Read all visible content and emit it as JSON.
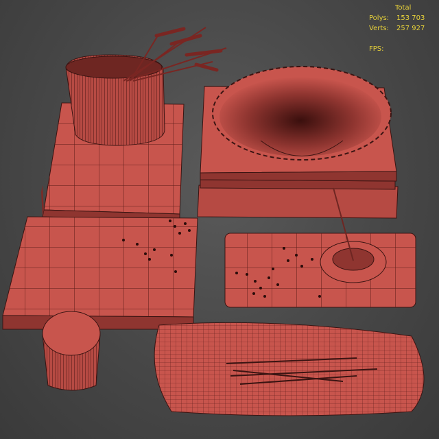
{
  "stats": {
    "header": "Total",
    "polys_label": "Polys:",
    "polys_value": "153 703",
    "verts_label": "Verts:",
    "verts_value": "257 927",
    "fps_label": "FPS:"
  },
  "colors": {
    "background": "#474747",
    "mesh_fill": "#c8554d",
    "mesh_dark": "#8f3530",
    "wire": "#3a1412",
    "stats_text": "#e8d23a"
  }
}
